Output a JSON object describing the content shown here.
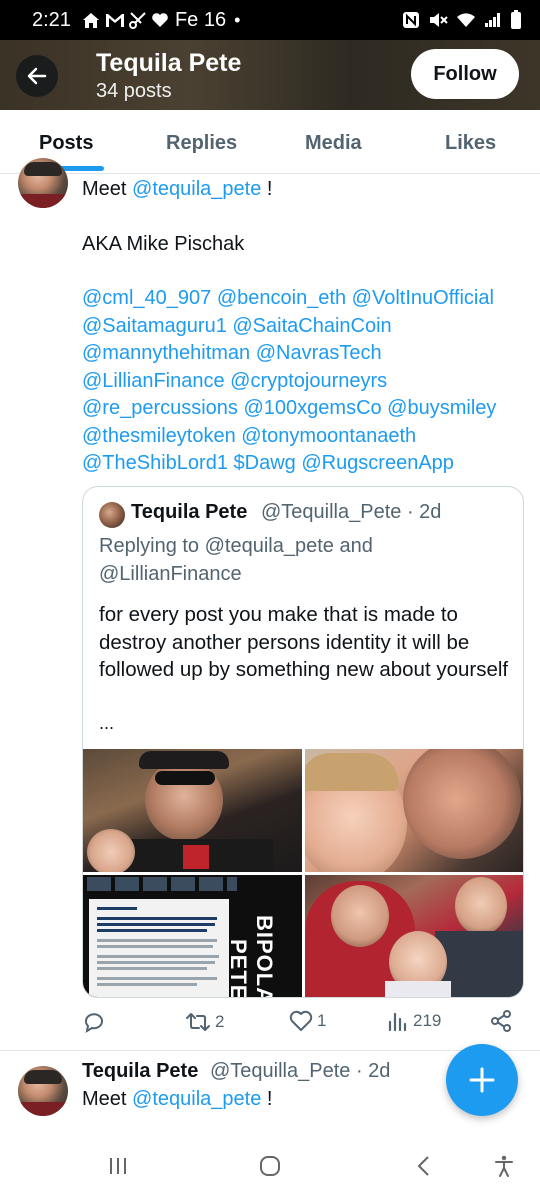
{
  "status_bar": {
    "time": "2:21",
    "date": "Fe 16",
    "dot": "•",
    "left_icons": [
      "home-icon",
      "gmail-icon",
      "scissors-icon",
      "heart-icon"
    ],
    "right_icons": [
      "nfc-icon",
      "mute-icon",
      "wifi-icon",
      "signal-icon",
      "battery-icon"
    ]
  },
  "header": {
    "name": "Tequila Pete",
    "posts_count": "34 posts",
    "follow_label": "Follow"
  },
  "tabs": [
    {
      "label": "Posts",
      "active": true
    },
    {
      "label": "Replies",
      "active": false
    },
    {
      "label": "Media",
      "active": false
    },
    {
      "label": "Likes",
      "active": false
    }
  ],
  "post1": {
    "intro": "Meet",
    "intro_mention": "@tequila_pete",
    "intro_end": "!",
    "aka": "AKA Mike Pischak",
    "mention_lines": [
      "@cml_40_907 @bencoin_eth @VoltInuOfficial",
      "@Saitamaguru1 @SaitaChainCoin",
      "@mannythehitman @NavrasTech",
      "@LillianFinance @cryptojourneyrs",
      "@re_percussions @100xgemsCo @buysmiley",
      "@thesmileytoken @tonymoontanaeth",
      "@TheShibLord1 $Dawg @RugscreenApp"
    ],
    "quote": {
      "name": "Tequila Pete",
      "handle": "@Tequilla_Pete · 2d",
      "reply_prefix": "Replying to",
      "reply_mention1": "@tequila_pete",
      "reply_and": "and",
      "reply_mention2": "@LillianFinance",
      "body": "for every post you make that is made to destroy another persons  identity it will be followed up by something new about yourself",
      "more": "...",
      "media_text_1": "BIPOLAR",
      "media_text_2": "PETE"
    },
    "actions": {
      "reply_count": "",
      "retweet_count": "2",
      "like_count": "1",
      "view_count": "219"
    }
  },
  "post2": {
    "name": "Tequila Pete",
    "handle": "@Tequilla_Pete · 2d",
    "text_intro": "Meet",
    "text_mention": "@tequila_pete",
    "text_end": "!"
  },
  "fab": {
    "icon": "plus-icon"
  },
  "nav_bar": {
    "icons": [
      "recent-apps-icon",
      "home-button-icon",
      "back-icon",
      "accessibility-icon"
    ]
  },
  "colors": {
    "accent": "#1d9bf0",
    "text": "#0f1419",
    "muted": "#536471"
  }
}
